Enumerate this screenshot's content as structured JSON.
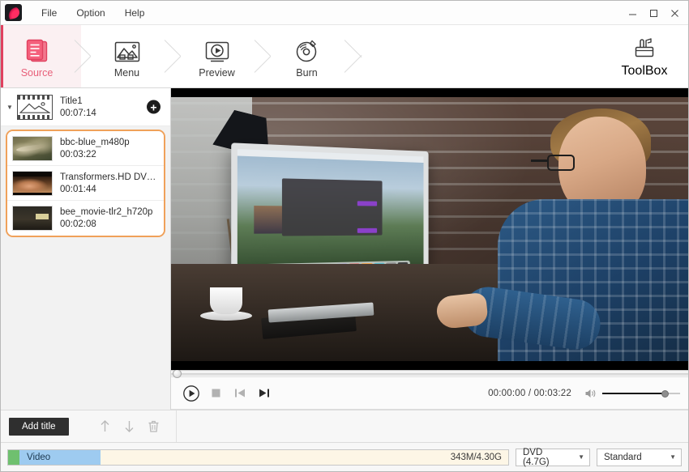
{
  "window": {
    "app_icon": "app-logo-icon",
    "minimize": "minimize-icon",
    "maximize": "maximize-icon",
    "close": "close-icon"
  },
  "menubar": {
    "items": [
      {
        "label": "File"
      },
      {
        "label": "Option"
      },
      {
        "label": "Help"
      }
    ]
  },
  "ribbon": {
    "steps": [
      {
        "label": "Source",
        "icon": "document-stack-icon",
        "active": true
      },
      {
        "label": "Menu",
        "icon": "picture-icon",
        "active": false
      },
      {
        "label": "Preview",
        "icon": "monitor-play-icon",
        "active": false
      },
      {
        "label": "Burn",
        "icon": "disc-burn-icon",
        "active": false
      }
    ],
    "toolbox": {
      "label": "ToolBox",
      "icon": "toolbox-icon"
    },
    "active_color": "#e8607a",
    "active_bg": "#fbf0f2",
    "active_accent": "#e0415f"
  },
  "sidebar": {
    "title": {
      "name": "Title1",
      "duration": "00:07:14",
      "collapse_icon": "chevron-down-icon",
      "thumb_icon": "film-image-icon",
      "add_label": "+"
    },
    "selection_color": "#f0a15a",
    "clips": [
      {
        "name": "bbc-blue_m480p",
        "duration": "00:03:22",
        "art": "art-bbc"
      },
      {
        "name": "Transformers.HD DVD...",
        "duration": "00:01:44",
        "art": "art-tf"
      },
      {
        "name": "bee_movie-tlr2_h720p",
        "duration": "00:02:08",
        "art": "art-bee"
      }
    ]
  },
  "preview": {
    "description": "Video frame: man in blue plaid shirt using an iMac at a desk with desk lamp, coffee cup and brick wall",
    "letterbox_color": "#000000"
  },
  "transport": {
    "buttons": [
      {
        "name": "play-button",
        "icon": "play-circle-icon",
        "enabled": true
      },
      {
        "name": "stop-button",
        "icon": "stop-icon",
        "enabled": false
      },
      {
        "name": "previous-button",
        "icon": "skip-back-icon",
        "enabled": false
      },
      {
        "name": "next-button",
        "icon": "skip-forward-icon",
        "enabled": true
      }
    ],
    "current_time": "00:00:00",
    "separator": "/",
    "total_time": "00:03:22",
    "time_display": "00:00:00 / 00:03:22",
    "volume_icon": "speaker-icon",
    "volume_percent": 78,
    "seek_percent": 0
  },
  "actionbar": {
    "add_title_label": "Add title",
    "buttons": [
      {
        "name": "move-up-button",
        "icon": "arrow-up-icon",
        "enabled": false
      },
      {
        "name": "move-down-button",
        "icon": "arrow-down-icon",
        "enabled": false
      },
      {
        "name": "delete-button",
        "icon": "trash-icon",
        "enabled": false
      }
    ]
  },
  "statusbar": {
    "track_label": "Video",
    "disk_usage": "343M/4.30G",
    "disc_type": {
      "value": "DVD (4.7G)",
      "caret": "chevron-down-icon"
    },
    "quality": {
      "value": "Standard",
      "caret": "chevron-down-icon"
    }
  }
}
